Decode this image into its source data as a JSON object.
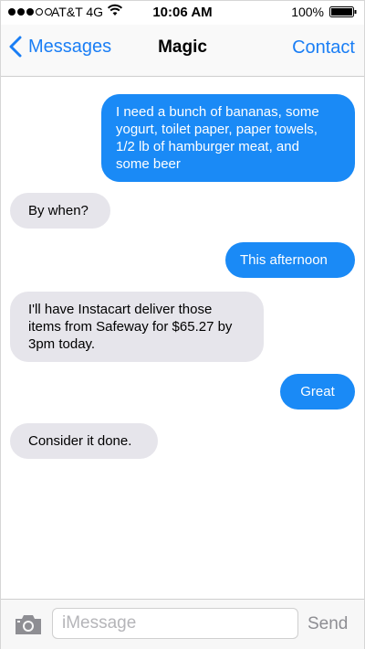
{
  "status_bar": {
    "carrier": "AT&T 4G",
    "time": "10:06 AM",
    "battery": "100%"
  },
  "nav": {
    "back_label": "Messages",
    "title": "Magic",
    "contact_label": "Contact"
  },
  "messages": [
    {
      "direction": "outgoing",
      "lines": [
        "I need a bunch of bananas, some",
        "yogurt, toilet paper, paper towels,",
        "1/2 lb of hamburger meat, and",
        "some beer"
      ]
    },
    {
      "direction": "incoming",
      "lines": [
        "By when?"
      ]
    },
    {
      "direction": "outgoing",
      "lines": [
        "This afternoon"
      ]
    },
    {
      "direction": "incoming",
      "lines": [
        "I'll have Instacart deliver those",
        "items from Safeway for $65.27 by",
        "3pm today."
      ]
    },
    {
      "direction": "outgoing",
      "lines": [
        "Great"
      ]
    },
    {
      "direction": "incoming",
      "lines": [
        "Consider it done."
      ]
    }
  ],
  "input": {
    "placeholder": "iMessage",
    "value": "",
    "send_label": "Send"
  },
  "colors": {
    "accent": "#1a7ef5",
    "outgoing_bubble": "#1a8af6",
    "incoming_bubble": "#e6e5eb"
  }
}
